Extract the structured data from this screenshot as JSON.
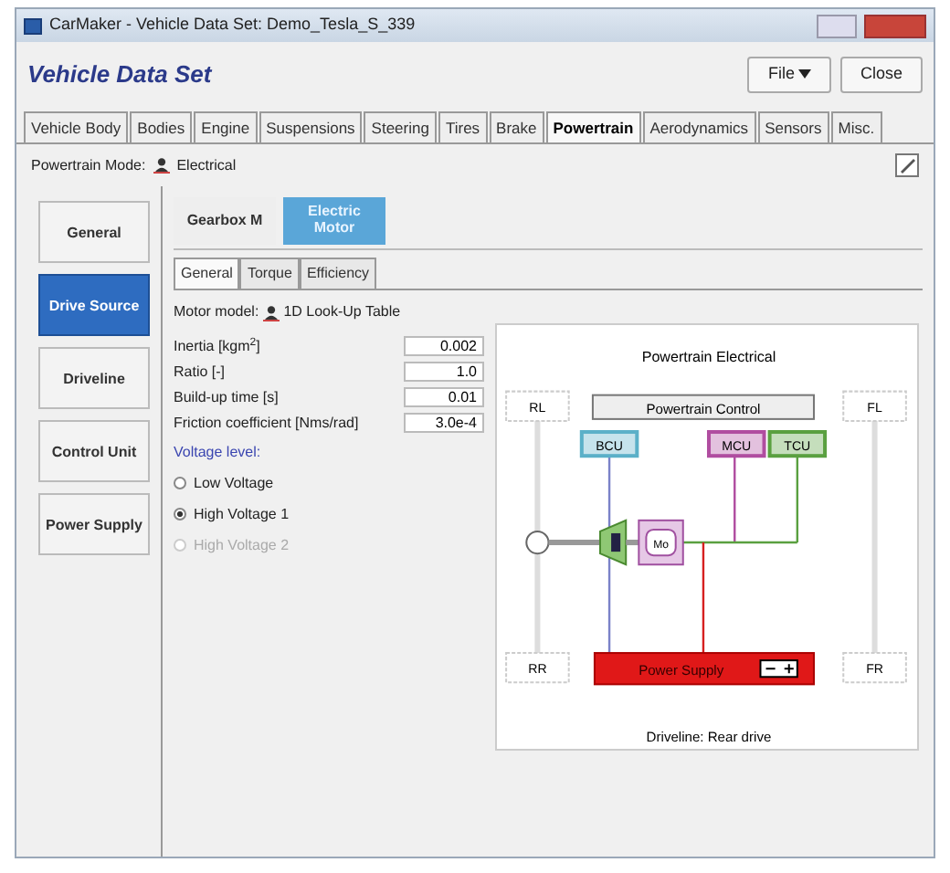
{
  "window": {
    "title": "CarMaker - Vehicle Data Set: Demo_Tesla_S_339"
  },
  "header": {
    "title": "Vehicle Data Set",
    "buttons": [
      {
        "label": "File",
        "kind": "menu"
      },
      {
        "label": "Close",
        "kind": "plain"
      }
    ]
  },
  "tabs": [
    {
      "label": "Vehicle Body",
      "selected": false
    },
    {
      "label": "Bodies",
      "selected": false
    },
    {
      "label": "Engine",
      "selected": false
    },
    {
      "label": "Suspensions",
      "selected": false
    },
    {
      "label": "Steering",
      "selected": false
    },
    {
      "label": "Tires",
      "selected": false
    },
    {
      "label": "Brake",
      "selected": false
    },
    {
      "label": "Powertrain",
      "selected": true
    },
    {
      "label": "Aerodynamics",
      "selected": false
    },
    {
      "label": "Sensors",
      "selected": false
    },
    {
      "label": "Misc.",
      "selected": false
    }
  ],
  "powertrain_mode": {
    "label": "Powertrain Mode:",
    "value": "Electrical"
  },
  "sidebar": {
    "items": [
      {
        "label": "General",
        "selected": false
      },
      {
        "label": "Drive Source",
        "selected": true
      },
      {
        "label": "Driveline",
        "selected": false
      },
      {
        "label": "Control Unit",
        "selected": false
      },
      {
        "label": "Power Supply",
        "selected": false
      }
    ]
  },
  "component_tabs": [
    {
      "label": "Gearbox M",
      "selected": false
    },
    {
      "label": "Electric Motor",
      "selected": true
    }
  ],
  "sub_tabs": [
    {
      "label": "General",
      "selected": true
    },
    {
      "label": "Torque",
      "selected": false
    },
    {
      "label": "Efficiency",
      "selected": false
    }
  ],
  "motor_model": {
    "label": "Motor model:",
    "value": "1D Look-Up Table"
  },
  "fields": [
    {
      "label": "Inertia [kgm$^{2}$]",
      "value": "0.002"
    },
    {
      "label": "Ratio [-]",
      "value": "1.0"
    },
    {
      "label": "Build-up time [s]",
      "value": "0.01"
    },
    {
      "label": "Friction coefficient [Nms/rad]",
      "value": "3.0e-4"
    }
  ],
  "voltage_level": {
    "label": "Voltage level:",
    "options": [
      {
        "label": "Low Voltage",
        "selected": false,
        "disabled": false
      },
      {
        "label": "High Voltage 1",
        "selected": true,
        "disabled": false
      },
      {
        "label": "High Voltage 2",
        "selected": false,
        "disabled": true
      }
    ]
  },
  "diagram": {
    "title": "Powertrain Electrical",
    "control": "Powertrain Control",
    "units": [
      {
        "label": "BCU",
        "color": "#5bb0c8"
      },
      {
        "label": "MCU",
        "color": "#b04da0"
      },
      {
        "label": "TCU",
        "color": "#5aa040"
      }
    ],
    "wheels": [
      "RL",
      "FL",
      "RR",
      "FR"
    ],
    "motor": "Mo",
    "power_supply": "Power Supply",
    "caption": "Driveline: Rear drive"
  }
}
